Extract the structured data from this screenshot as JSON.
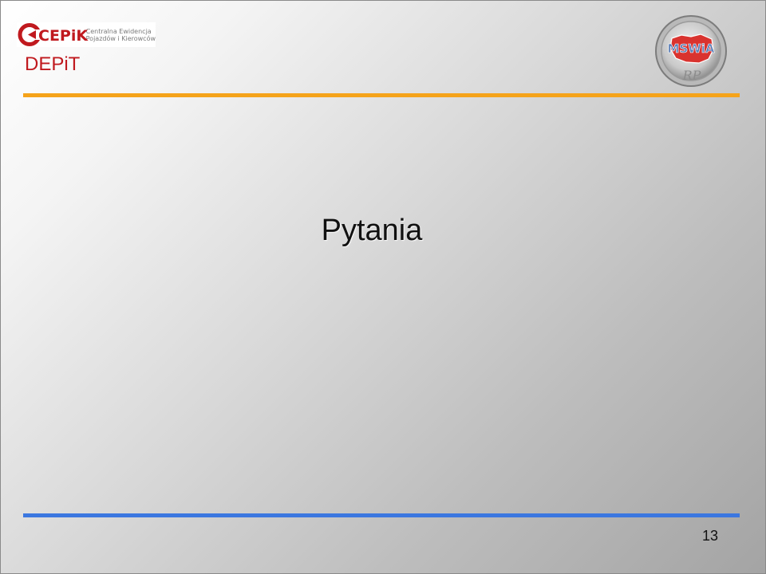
{
  "header": {
    "logo_left": {
      "brand": "CEPiK",
      "line1": "Centralna Ewidencja",
      "line2": "Pojazdów i Kierowców"
    },
    "title": "DEPiT",
    "logo_right": {
      "badge": "MSWiA",
      "script": "RP"
    }
  },
  "slide": {
    "title": "Pytania",
    "page_number": "13"
  },
  "colors": {
    "title_red": "#c0191e",
    "rule_top": "#f5a31a",
    "rule_bottom": "#3b77e0"
  }
}
